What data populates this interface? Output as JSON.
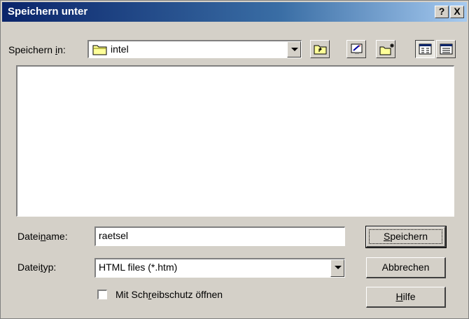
{
  "window": {
    "title": "Speichern unter",
    "help_button": "?",
    "close_button": "X"
  },
  "lookin": {
    "label_pre": "Speichern ",
    "label_key": "i",
    "label_post": "n:",
    "value": "intel",
    "icon": "folder-icon"
  },
  "toolbar": {
    "up": "up-folder-icon",
    "desktop": "desktop-icon",
    "newfolder": "new-folder-icon",
    "list": "list-view-icon",
    "details": "details-view-icon"
  },
  "filename": {
    "label_pre": "Datei",
    "label_key": "n",
    "label_post": "ame:",
    "value": "raetsel"
  },
  "filetype": {
    "label_pre": "Datei",
    "label_key": "t",
    "label_post": "yp:",
    "value": "HTML files (*.htm)"
  },
  "readonly": {
    "label_pre": "Mit Sch",
    "label_key": "r",
    "label_post": "eibschutz öffnen",
    "checked": false
  },
  "buttons": {
    "save": {
      "key": "S",
      "rest": "peichern"
    },
    "cancel": {
      "label": "Abbrechen"
    },
    "help": {
      "key": "H",
      "rest": "ilfe"
    }
  }
}
